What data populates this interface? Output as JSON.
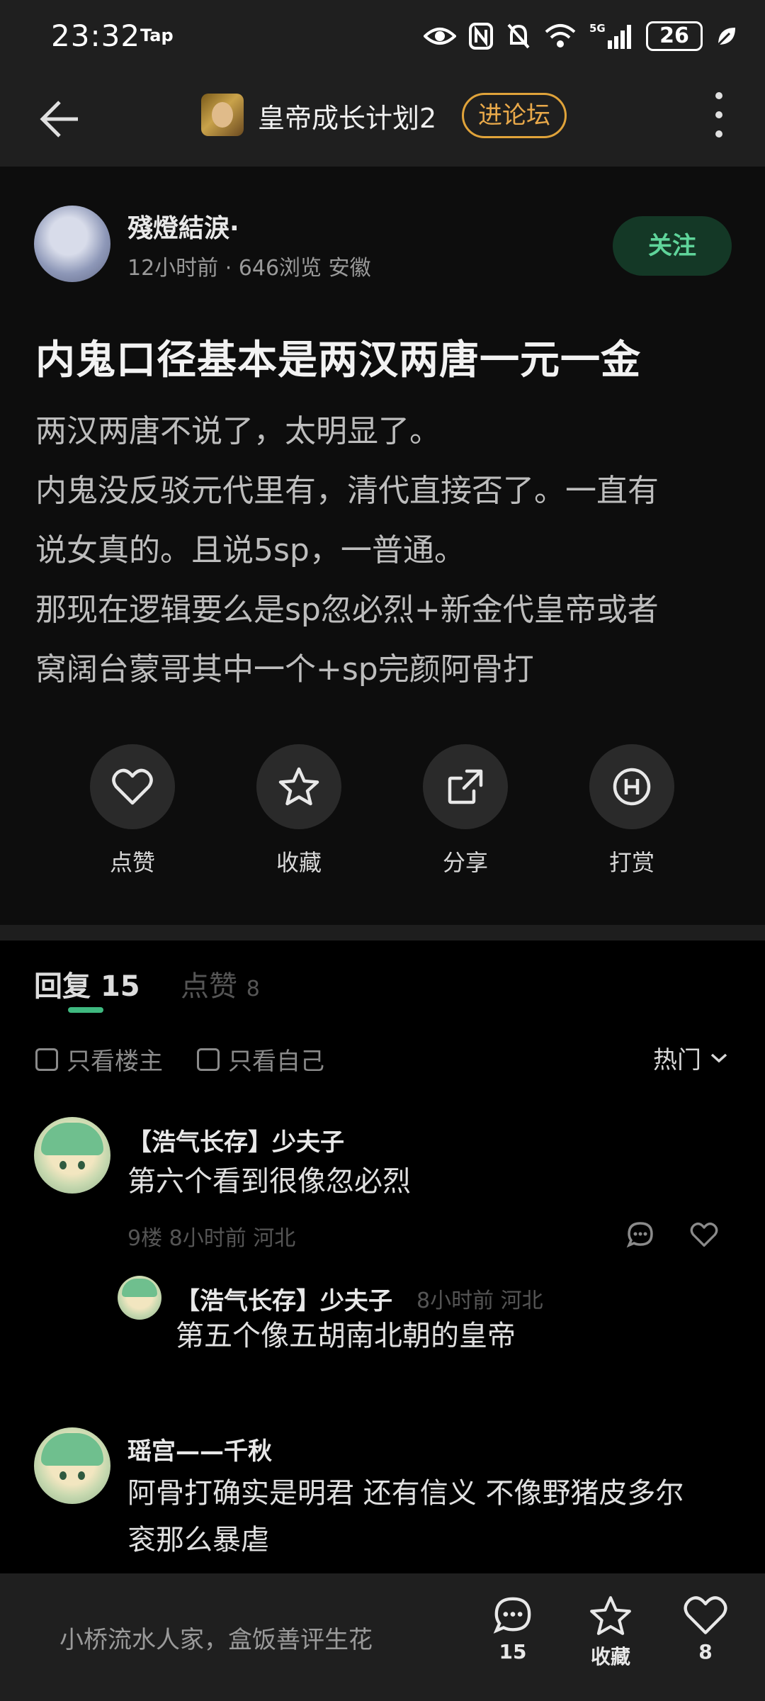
{
  "status_bar": {
    "time": "23:32",
    "carrier_tag": "Tap",
    "network": "5G",
    "battery": "26"
  },
  "header": {
    "title": "皇帝成长计划2",
    "forum_button": "进论坛",
    "game_icon": "game-emperor-icon"
  },
  "post": {
    "author": "殘燈結淚·",
    "meta": "12小时前 · 646浏览  安徽",
    "follow_label": "关注",
    "title": "内鬼口径基本是两汉两唐一元一金",
    "body_lines": [
      "两汉两唐不说了，太明显了。",
      "内鬼没反驳元代里有，清代直接否了。一直有",
      "说女真的。且说5sp，一普通。",
      "那现在逻辑要么是sp忽必烈+新金代皇帝或者",
      "窝阔台蒙哥其中一个+sp完颜阿骨打"
    ],
    "actions": [
      {
        "label": "点赞",
        "icon": "heart-icon"
      },
      {
        "label": "收藏",
        "icon": "star-icon"
      },
      {
        "label": "分享",
        "icon": "share-icon"
      },
      {
        "label": "打赏",
        "icon": "reward-icon"
      }
    ]
  },
  "comments_section": {
    "tab_reply_label": "回复",
    "tab_reply_count": "15",
    "tab_like_label": "点赞",
    "tab_like_count": "8",
    "filter_owner": "只看楼主",
    "filter_self": "只看自己",
    "sort_label": "热门",
    "comments": [
      {
        "name": "【浩气长存】少夫子",
        "text": "第六个看到很像忽必烈",
        "meta": "9楼  8小时前  河北",
        "reply": {
          "name": "【浩气长存】少夫子",
          "meta": "8小时前  河北",
          "text": "第五个像五胡南北朝的皇帝"
        }
      },
      {
        "name": "瑶宫——千秋",
        "text_lines": [
          "阿骨打确实是明君 还有信义 不像野猪皮多尔",
          "衮那么暴虐"
        ]
      }
    ]
  },
  "bottom_bar": {
    "input_placeholder": "小桥流水人家，盒饭善评生花",
    "comment_count": "15",
    "collect_label": "收藏",
    "like_count": "8"
  },
  "colors": {
    "accent_green": "#3fb980",
    "forum_orange": "#e0a33a",
    "follow_bg": "#143826"
  }
}
